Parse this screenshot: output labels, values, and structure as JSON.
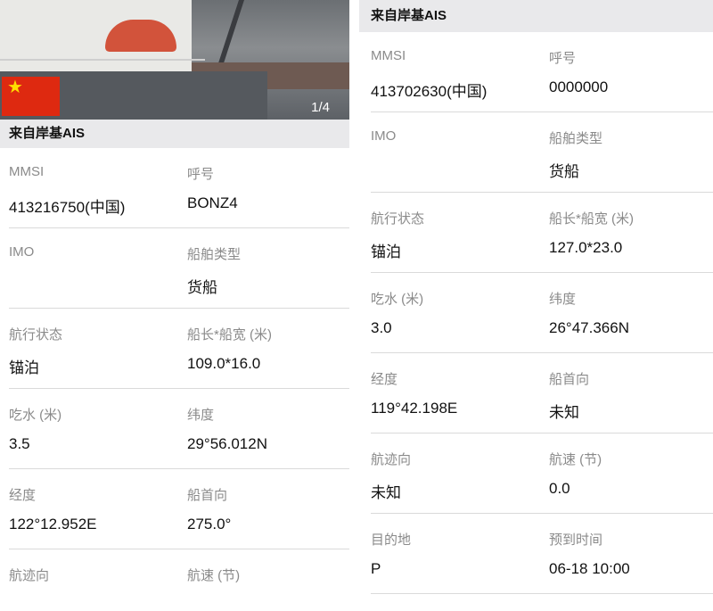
{
  "left": {
    "photo": {
      "pager": "1/4"
    },
    "header": "来自岸基AIS",
    "rows": [
      {
        "l1": "MMSI",
        "v1": "413216750(中国)",
        "l2": "呼号",
        "v2": "BONZ4"
      },
      {
        "l1": "IMO",
        "v1": "",
        "l2": "船舶类型",
        "v2": "货船"
      },
      {
        "l1": "航行状态",
        "v1": "锚泊",
        "l2": "船长*船宽 (米)",
        "v2": "109.0*16.0"
      },
      {
        "l1": "吃水 (米)",
        "v1": "3.5",
        "l2": "纬度",
        "v2": "29°56.012N"
      },
      {
        "l1": "经度",
        "v1": "122°12.952E",
        "l2": "船首向",
        "v2": "275.0°"
      },
      {
        "l1": "航迹向",
        "v1": "",
        "l2": "航速 (节)",
        "v2": ""
      }
    ]
  },
  "right": {
    "header": "来自岸基AIS",
    "rows": [
      {
        "l1": "MMSI",
        "v1": "413702630(中国)",
        "l2": "呼号",
        "v2": "0000000"
      },
      {
        "l1": "IMO",
        "v1": "",
        "l2": "船舶类型",
        "v2": "货船"
      },
      {
        "l1": "航行状态",
        "v1": "锚泊",
        "l2": "船长*船宽 (米)",
        "v2": "127.0*23.0"
      },
      {
        "l1": "吃水 (米)",
        "v1": "3.0",
        "l2": "纬度",
        "v2": "26°47.366N"
      },
      {
        "l1": "经度",
        "v1": "119°42.198E",
        "l2": "船首向",
        "v2": "未知"
      },
      {
        "l1": "航迹向",
        "v1": "未知",
        "l2": "航速 (节)",
        "v2": "0.0"
      },
      {
        "l1": "目的地",
        "v1": "P",
        "l2": "预到时间",
        "v2": "06-18 10:00"
      }
    ]
  }
}
